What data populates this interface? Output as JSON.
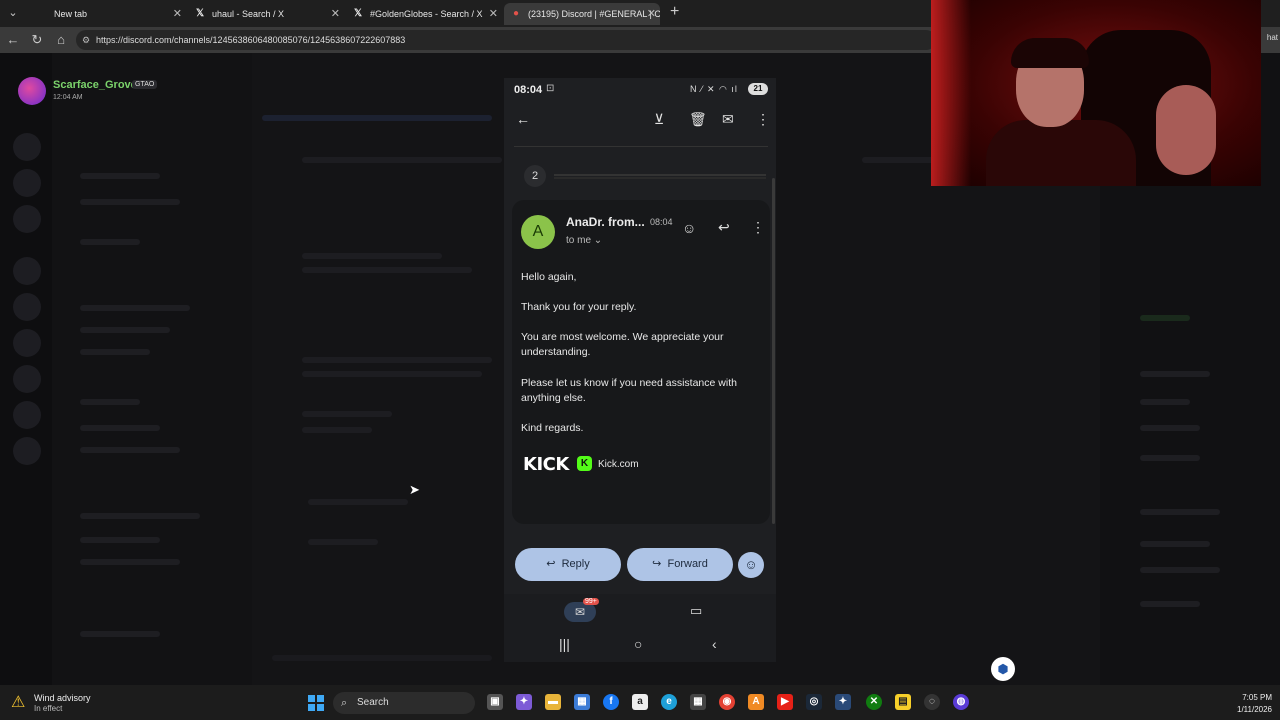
{
  "browser": {
    "tabs": [
      {
        "label": "New tab",
        "icon": "newtab-icon"
      },
      {
        "label": "uhaul - Search / X",
        "icon": "x-logo-icon"
      },
      {
        "label": "#GoldenGlobes - Search / X",
        "icon": "x-logo-icon"
      },
      {
        "label": "(23195) Discord | #GENERAL | Cellfi",
        "icon": "discord-icon"
      }
    ],
    "url": "https://discord.com/channels/1245638606480085076/1245638607222607883",
    "right_text": "hat"
  },
  "discord": {
    "user_name": "Scarface_Grove",
    "user_badge": "GTAO",
    "user_time": "12:04 AM"
  },
  "phone": {
    "status_time": "08:04",
    "battery": "21",
    "collapsed_count": "2",
    "message": {
      "avatar_letter": "A",
      "sender": "AnaDr. from...",
      "time": "08:04",
      "recipient": "to me",
      "body": [
        "Hello again,",
        "Thank you for your reply.",
        "You are most welcome. We appreciate your understanding.",
        "Please let us know if you need assistance with anything else.",
        "Kind regards."
      ],
      "signature_logo": "KICK",
      "signature_site": "Kick.com"
    },
    "actions": {
      "reply": "Reply",
      "forward": "Forward"
    },
    "mail_badge": "99+"
  },
  "taskbar": {
    "weather_title": "Wind advisory",
    "weather_sub": "In effect",
    "search_label": "Search",
    "time": "7:05 PM",
    "date": "1/11/2026"
  },
  "colors": {
    "accent_button": "#aec4e6",
    "avatar_green": "#8bc34a",
    "kick_green": "#53fc18",
    "discord_user": "#7bd36b"
  }
}
